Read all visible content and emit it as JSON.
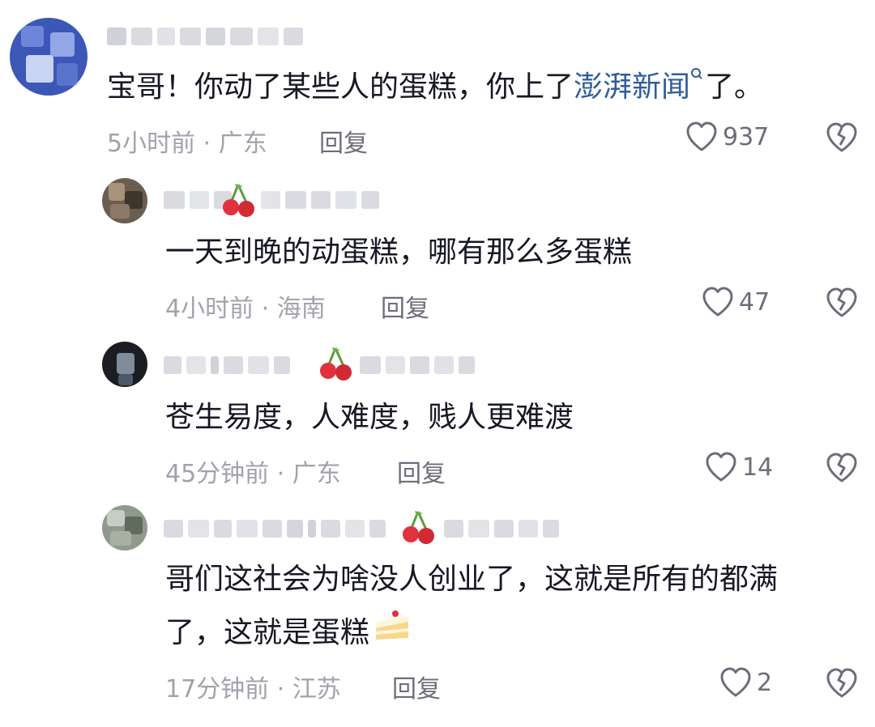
{
  "comments": [
    {
      "text_before": "宝哥！你动了某些人的蛋糕，你上了",
      "link": "澎湃新闻",
      "text_after": "了。",
      "time": "5小时前 · 广东",
      "reply": "回复",
      "likes": "937"
    },
    {
      "text": "一天到晚的动蛋糕，哪有那么多蛋糕",
      "time": "4小时前 · 海南",
      "reply": "回复",
      "likes": "47"
    },
    {
      "text": "苍生易度，人难度，贱人更难渡",
      "time": "45分钟前 · 广东",
      "reply": "回复",
      "likes": "14"
    },
    {
      "line1": "哥们这社会为啥没人创业了，这就是所有的都满",
      "line2": "了，这就是蛋糕",
      "time": "17分钟前 · 江苏",
      "reply": "回复",
      "likes": "2"
    }
  ],
  "icons": {
    "like": "heart-outline-icon",
    "dislike": "broken-heart-icon",
    "search": "search-icon",
    "cherry": "cherry-icon",
    "cake": "cake-emoji"
  },
  "colors": {
    "text": "#161823",
    "meta": "#a1a3ab",
    "link": "#2f5d9a",
    "cherry": "#e0313c"
  }
}
